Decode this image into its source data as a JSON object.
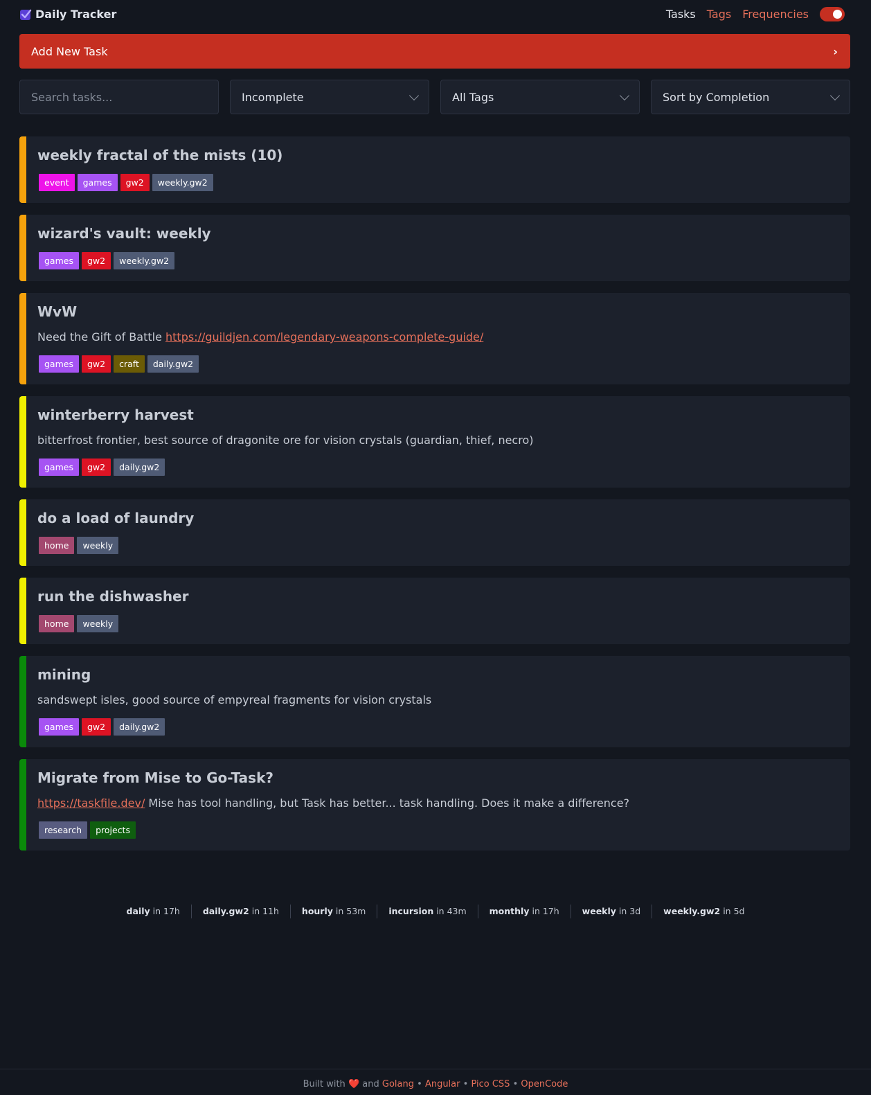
{
  "header": {
    "title": "Daily Tracker",
    "nav": {
      "tasks": "Tasks",
      "tags": "Tags",
      "frequencies": "Frequencies"
    },
    "accent": "#c52f21"
  },
  "add_task": {
    "label": "Add New Task"
  },
  "filters": {
    "search_placeholder": "Search tasks...",
    "status": "Incomplete",
    "tags": "All Tags",
    "sort": "Sort by Completion"
  },
  "tasks": [
    {
      "title": "weekly fractal of the mists (10)",
      "stripe": "#f5a20c",
      "tags": [
        {
          "label": "event",
          "color": "#ee13e9"
        },
        {
          "label": "games",
          "color": "#a653f3"
        },
        {
          "label": "gw2",
          "color": "#dd1324"
        },
        {
          "label": "weekly.gw2",
          "color": "#4f5b75"
        }
      ]
    },
    {
      "title": "wizard's vault: weekly",
      "stripe": "#f5a20c",
      "tags": [
        {
          "label": "games",
          "color": "#a653f3"
        },
        {
          "label": "gw2",
          "color": "#dd1324"
        },
        {
          "label": "weekly.gw2",
          "color": "#4f5b75"
        }
      ]
    },
    {
      "title": "WvW",
      "stripe": "#f5a20c",
      "desc_text": "Need the Gift of Battle ",
      "desc_link": "https://guildjen.com/legendary-weapons-complete-guide/",
      "tags": [
        {
          "label": "games",
          "color": "#a653f3"
        },
        {
          "label": "gw2",
          "color": "#dd1324"
        },
        {
          "label": "craft",
          "color": "#6b5b05"
        },
        {
          "label": "daily.gw2",
          "color": "#4f5b75"
        }
      ]
    },
    {
      "title": "winterberry harvest",
      "stripe": "#f0f000",
      "desc_text": "bitterfrost frontier, best source of dragonite ore for vision crystals (guardian, thief, necro)",
      "tags": [
        {
          "label": "games",
          "color": "#a653f3"
        },
        {
          "label": "gw2",
          "color": "#dd1324"
        },
        {
          "label": "daily.gw2",
          "color": "#4f5b75"
        }
      ]
    },
    {
      "title": "do a load of laundry",
      "stripe": "#f0f000",
      "tags": [
        {
          "label": "home",
          "color": "#a3486f"
        },
        {
          "label": "weekly",
          "color": "#4f5b75"
        }
      ]
    },
    {
      "title": "run the dishwasher",
      "stripe": "#f0f000",
      "tags": [
        {
          "label": "home",
          "color": "#a3486f"
        },
        {
          "label": "weekly",
          "color": "#4f5b75"
        }
      ]
    },
    {
      "title": "mining",
      "stripe": "#0a8a0a",
      "desc_text": "sandswept isles, good source of empyreal fragments for vision crystals",
      "tags": [
        {
          "label": "games",
          "color": "#a653f3"
        },
        {
          "label": "gw2",
          "color": "#dd1324"
        },
        {
          "label": "daily.gw2",
          "color": "#4f5b75"
        }
      ]
    },
    {
      "title": "Migrate from Mise to Go-Task?",
      "stripe": "#0a8a0a",
      "desc_link": "https://taskfile.dev/",
      "desc_text_after": " Mise has tool handling, but Task has better... task handling. Does it make a difference?",
      "tags": [
        {
          "label": "research",
          "color": "#585c80"
        },
        {
          "label": "projects",
          "color": "#0f5e0f"
        }
      ]
    }
  ],
  "resets": [
    {
      "name": "daily",
      "when": "in 17h"
    },
    {
      "name": "daily.gw2",
      "when": "in 11h"
    },
    {
      "name": "hourly",
      "when": "in 53m"
    },
    {
      "name": "incursion",
      "when": "in 43m"
    },
    {
      "name": "monthly",
      "when": "in 17h"
    },
    {
      "name": "weekly",
      "when": "in 3d"
    },
    {
      "name": "weekly.gw2",
      "when": "in 5d"
    }
  ],
  "footer": {
    "built_with": "Built with",
    "and": "and",
    "sep": "•",
    "links": [
      "Golang",
      "Angular",
      "Pico CSS",
      "OpenCode"
    ]
  }
}
